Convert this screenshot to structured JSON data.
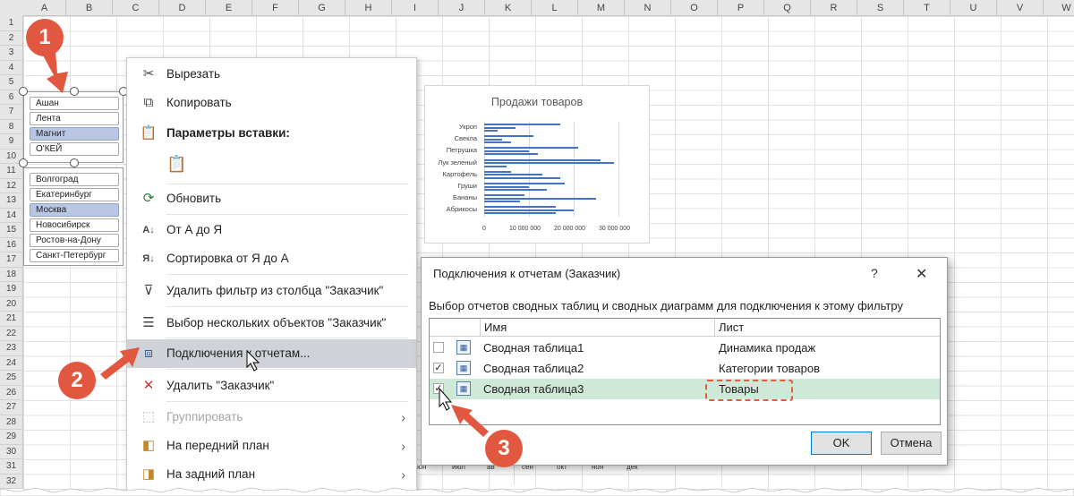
{
  "sheet": {
    "columns": [
      "A",
      "B",
      "C",
      "D",
      "E",
      "F",
      "G",
      "H",
      "I",
      "J",
      "K",
      "L",
      "M",
      "N",
      "O",
      "P",
      "Q",
      "R",
      "S",
      "T",
      "U",
      "V",
      "W"
    ],
    "rows": [
      "1",
      "2",
      "3",
      "4",
      "5",
      "6",
      "7",
      "8",
      "9",
      "10",
      "11",
      "12",
      "13",
      "14",
      "15",
      "16",
      "17",
      "18",
      "19",
      "20",
      "21",
      "22",
      "23",
      "24",
      "25",
      "26",
      "27",
      "28",
      "29",
      "30",
      "31",
      "32"
    ]
  },
  "slicer_top": {
    "items": [
      {
        "label": "Ашан",
        "selected": false
      },
      {
        "label": "Лента",
        "selected": false
      },
      {
        "label": "Магнит",
        "selected": true
      },
      {
        "label": "О'КЕЙ",
        "selected": false
      }
    ]
  },
  "slicer_bottom": {
    "items": [
      {
        "label": "Волгоград",
        "selected": false
      },
      {
        "label": "Екатеринбург",
        "selected": false
      },
      {
        "label": "Москва",
        "selected": true
      },
      {
        "label": "Новосибирск",
        "selected": false
      },
      {
        "label": "Ростов-на-Дону",
        "selected": false
      },
      {
        "label": "Санкт-Петербург",
        "selected": false
      }
    ]
  },
  "context_menu": {
    "cut": "Вырезать",
    "copy": "Копировать",
    "paste_options": "Параметры вставки:",
    "refresh": "Обновить",
    "sort_az": "От А до Я",
    "sort_za": "Сортировка от Я до А",
    "clear_filter": "Удалить фильтр из столбца \"Заказчик\"",
    "multi_select": "Выбор нескольких объектов \"Заказчик\"",
    "report_connections": "Подключения к отчетам...",
    "delete": "Удалить \"Заказчик\"",
    "group": "Группировать",
    "bring_forward": "На передний план",
    "send_backward": "На задний план"
  },
  "chart_data": {
    "type": "bar",
    "title": "Продажи товаров",
    "categories": [
      "Укроп",
      "Свекла",
      "Петрушка",
      "Лук зеленый",
      "Картофель",
      "Груши",
      "Бананы",
      "Абрикосы"
    ],
    "series": [
      {
        "values": [
          17000000,
          11000000,
          21000000,
          26000000,
          6000000,
          18000000,
          9000000,
          16000000
        ]
      },
      {
        "values": [
          7000000,
          4000000,
          10000000,
          29000000,
          13000000,
          10000000,
          25000000,
          20000000
        ]
      },
      {
        "values": [
          3000000,
          6000000,
          12000000,
          5000000,
          17000000,
          14000000,
          8000000,
          16000000
        ]
      }
    ],
    "xticks": [
      "0",
      "10 000 000",
      "20 000 000",
      "30 000 000"
    ],
    "xlim": [
      0,
      30000000
    ]
  },
  "chart_months": [
    "юн",
    "июл",
    "ав",
    "сен",
    "окт",
    "ноя",
    "дек"
  ],
  "dialog": {
    "title": "Подключения к отчетам (Заказчик)",
    "help": "?",
    "close": "✕",
    "description": "Выбор отчетов сводных таблиц и сводных диаграмм для подключения к этому фильтру",
    "col_name": "Имя",
    "col_sheet": "Лист",
    "rows": [
      {
        "name": "Сводная таблица1",
        "sheet": "Динамика продаж",
        "checked": false
      },
      {
        "name": "Сводная таблица2",
        "sheet": "Категории товаров",
        "checked": true
      },
      {
        "name": "Сводная таблица3",
        "sheet": "Товары",
        "checked": true
      }
    ],
    "ok": "OK",
    "cancel": "Отмена"
  },
  "badges": [
    "1",
    "2",
    "3"
  ],
  "colors": {
    "accent": "#e2573f",
    "bar": "#4472c4",
    "highlight": "#cfe9d8"
  }
}
